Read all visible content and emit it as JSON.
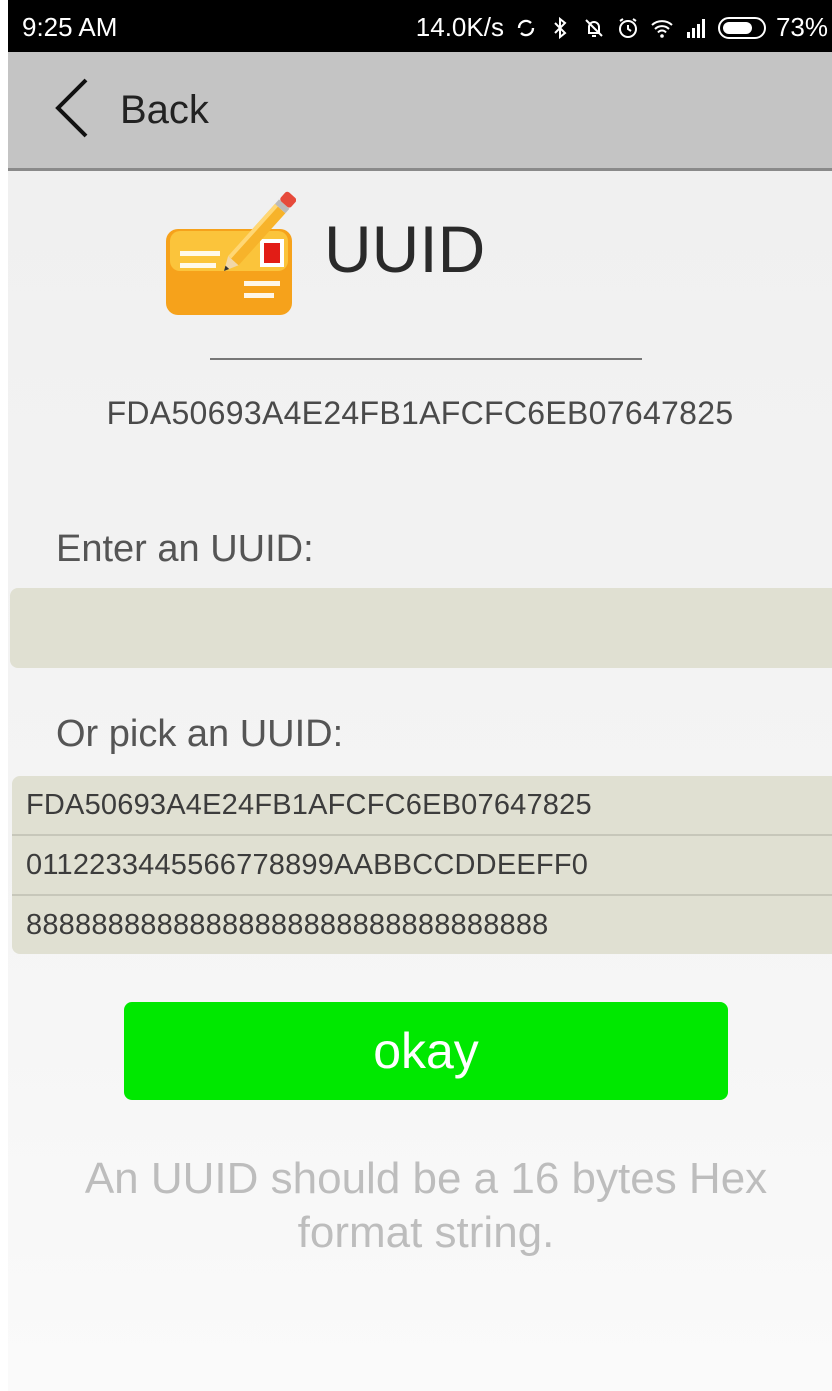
{
  "status_bar": {
    "time": "9:25 AM",
    "network_speed": "14.0K/s",
    "battery_percent": "73%",
    "battery_level": 0.73,
    "icons": [
      "sync-icon",
      "bluetooth-icon",
      "mute-icon",
      "alarm-icon",
      "wifi-icon",
      "signal-icon",
      "battery-icon"
    ]
  },
  "nav": {
    "back_label": "Back"
  },
  "header": {
    "title": "UUID",
    "icon": "envelope-pencil-icon"
  },
  "current_uuid": "FDA50693A4E24FB1AFCFC6EB07647825",
  "form": {
    "enter_label": "Enter an UUID:",
    "input_value": "",
    "pick_label": "Or pick an UUID:",
    "options": [
      "FDA50693A4E24FB1AFCFC6EB07647825",
      "0112233445566778899AABBCCDDEEFF0",
      "88888888888888888888888888888888"
    ]
  },
  "okay_button": {
    "label": "okay",
    "color": "#00e800"
  },
  "hint": "An UUID should be a 16 bytes Hex format string.",
  "colors": {
    "nav_bg": "#c4c4c4",
    "field_bg": "#e0e0d2",
    "hint_text": "#bdbdbd"
  }
}
